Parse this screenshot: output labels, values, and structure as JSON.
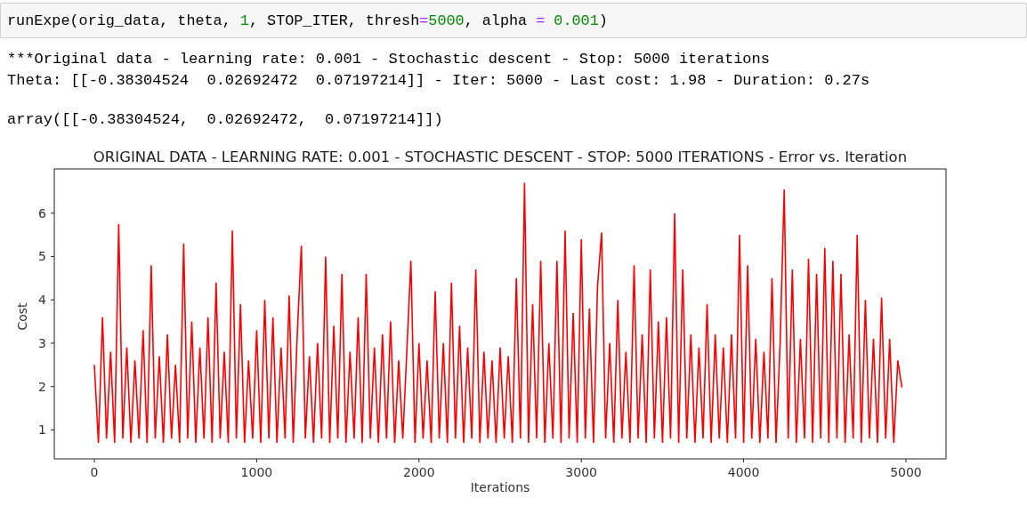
{
  "input_cell": {
    "code": [
      {
        "kind": "plain",
        "text": "runExpe(orig_data, theta, "
      },
      {
        "kind": "number",
        "text": "1"
      },
      {
        "kind": "plain",
        "text": ", STOP_ITER, thresh"
      },
      {
        "kind": "operator",
        "text": "="
      },
      {
        "kind": "number",
        "text": "5000"
      },
      {
        "kind": "plain",
        "text": ", alpha "
      },
      {
        "kind": "operator",
        "text": "="
      },
      {
        "kind": "number",
        "text": " 0.001"
      },
      {
        "kind": "plain",
        "text": ")"
      }
    ]
  },
  "stdout": [
    "***Original data - learning rate: 0.001 - Stochastic descent - Stop: 5000 iterations",
    "Theta: [[-0.38304524  0.02692472  0.07197214]] - Iter: 5000 - Last cost: 1.98 - Duration: 0.27s"
  ],
  "result": "array([[-0.38304524,  0.02692472,  0.07197214]])",
  "plot": {
    "chart_data": {
      "type": "line",
      "title": "ORIGINAL DATA - LEARNING RATE: 0.001 - STOCHASTIC DESCENT - STOP: 5000 ITERATIONS - Error vs. Iteration",
      "xlabel": "Iterations",
      "ylabel": "Cost",
      "xlim": [
        -247,
        5247
      ],
      "x": [
        0,
        25,
        50,
        75,
        100,
        125,
        150,
        175,
        200,
        225,
        250,
        275,
        300,
        325,
        350,
        375,
        400,
        425,
        450,
        475,
        500,
        525,
        550,
        575,
        600,
        625,
        650,
        675,
        700,
        725,
        750,
        775,
        800,
        825,
        850,
        875,
        900,
        925,
        950,
        975,
        1000,
        1025,
        1050,
        1075,
        1100,
        1125,
        1150,
        1175,
        1200,
        1225,
        1250,
        1275,
        1300,
        1325,
        1350,
        1375,
        1400,
        1425,
        1450,
        1475,
        1500,
        1525,
        1550,
        1575,
        1600,
        1625,
        1650,
        1675,
        1700,
        1725,
        1750,
        1775,
        1800,
        1825,
        1850,
        1875,
        1900,
        1925,
        1950,
        1975,
        2000,
        2025,
        2050,
        2075,
        2100,
        2125,
        2150,
        2175,
        2200,
        2225,
        2250,
        2275,
        2300,
        2325,
        2350,
        2375,
        2400,
        2425,
        2450,
        2475,
        2500,
        2525,
        2550,
        2575,
        2600,
        2625,
        2650,
        2675,
        2700,
        2725,
        2750,
        2775,
        2800,
        2825,
        2850,
        2875,
        2900,
        2925,
        2950,
        2975,
        3000,
        3025,
        3050,
        3075,
        3100,
        3125,
        3150,
        3175,
        3200,
        3225,
        3250,
        3275,
        3300,
        3325,
        3350,
        3375,
        3400,
        3425,
        3450,
        3475,
        3500,
        3525,
        3550,
        3575,
        3600,
        3625,
        3650,
        3675,
        3700,
        3725,
        3750,
        3775,
        3800,
        3825,
        3850,
        3875,
        3900,
        3925,
        3950,
        3975,
        4000,
        4025,
        4050,
        4075,
        4100,
        4125,
        4150,
        4175,
        4200,
        4225,
        4250,
        4275,
        4300,
        4325,
        4350,
        4375,
        4400,
        4425,
        4450,
        4475,
        4500,
        4525,
        4550,
        4575,
        4600,
        4625,
        4650,
        4675,
        4700,
        4725,
        4750,
        4775,
        4800,
        4825,
        4850,
        4875,
        4900,
        4925,
        4950,
        4975
      ],
      "ylim": [
        0.33,
        7.02
      ],
      "xticks": [
        0,
        1000,
        2000,
        3000,
        4000,
        5000
      ],
      "yticks": [
        1,
        2,
        3,
        4,
        5,
        6
      ],
      "series": [
        {
          "color": "#ff0000",
          "values": [
            2.5,
            0.7,
            3.6,
            0.8,
            2.8,
            0.7,
            5.75,
            0.8,
            2.9,
            0.7,
            2.6,
            0.8,
            3.3,
            0.7,
            4.8,
            0.8,
            2.7,
            0.7,
            3.2,
            0.8,
            2.5,
            0.7,
            5.3,
            0.8,
            3.5,
            0.7,
            2.9,
            0.8,
            3.6,
            0.7,
            4.4,
            0.8,
            2.8,
            0.7,
            5.6,
            0.8,
            3.9,
            0.7,
            2.6,
            0.8,
            3.3,
            0.7,
            4.0,
            0.8,
            3.6,
            0.7,
            2.9,
            0.8,
            4.1,
            0.7,
            3.2,
            5.25,
            0.8,
            2.7,
            0.7,
            3.0,
            0.8,
            5.0,
            0.7,
            3.4,
            0.8,
            4.6,
            0.7,
            2.8,
            0.8,
            3.6,
            0.7,
            4.6,
            0.8,
            2.9,
            0.7,
            3.2,
            0.8,
            3.5,
            0.7,
            2.6,
            0.8,
            2.8,
            4.9,
            0.7,
            3.0,
            0.8,
            2.6,
            0.7,
            4.2,
            0.8,
            3.0,
            0.7,
            4.4,
            0.8,
            3.4,
            0.7,
            2.9,
            0.8,
            4.7,
            0.7,
            2.8,
            0.8,
            2.6,
            0.7,
            2.9,
            0.8,
            2.7,
            0.7,
            4.5,
            0.8,
            6.7,
            0.7,
            3.9,
            0.8,
            4.9,
            0.7,
            3.0,
            0.8,
            4.9,
            0.7,
            5.6,
            0.8,
            3.7,
            0.7,
            5.4,
            0.8,
            3.8,
            0.7,
            4.3,
            5.55,
            0.8,
            3.0,
            0.7,
            4.0,
            0.8,
            2.8,
            0.7,
            4.8,
            0.8,
            3.2,
            0.7,
            4.7,
            0.8,
            3.5,
            0.7,
            3.6,
            0.8,
            6.0,
            0.7,
            4.7,
            0.8,
            3.2,
            0.7,
            2.9,
            0.8,
            3.9,
            0.7,
            3.2,
            0.8,
            2.9,
            0.7,
            3.2,
            0.8,
            5.5,
            0.7,
            4.8,
            0.8,
            3.1,
            0.7,
            2.8,
            0.8,
            4.5,
            0.7,
            3.0,
            6.55,
            0.8,
            4.7,
            0.7,
            3.1,
            0.8,
            4.95,
            0.7,
            4.6,
            0.8,
            5.2,
            0.7,
            4.9,
            0.8,
            4.6,
            0.7,
            3.2,
            0.8,
            5.5,
            0.7,
            4.0,
            0.8,
            3.1,
            0.7,
            4.05,
            0.8,
            3.1,
            0.7,
            2.6,
            1.98
          ]
        }
      ]
    }
  }
}
